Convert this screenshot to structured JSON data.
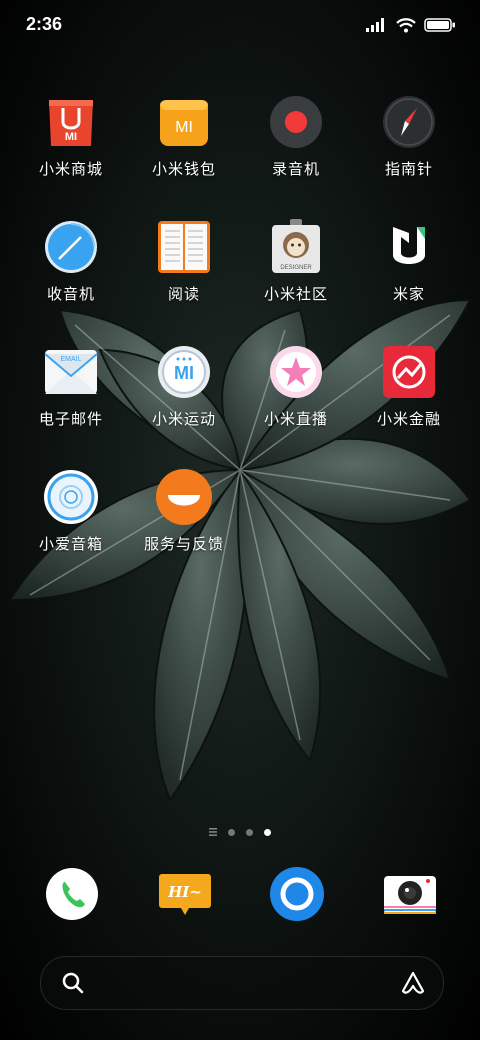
{
  "status_bar": {
    "time": "2:36"
  },
  "apps": [
    {
      "label": "小米商城",
      "icon": "mi-store-icon"
    },
    {
      "label": "小米钱包",
      "icon": "mi-wallet-icon"
    },
    {
      "label": "录音机",
      "icon": "recorder-icon"
    },
    {
      "label": "指南针",
      "icon": "compass-icon"
    },
    {
      "label": "收音机",
      "icon": "radio-icon"
    },
    {
      "label": "阅读",
      "icon": "reader-icon"
    },
    {
      "label": "小米社区",
      "icon": "mi-community-icon"
    },
    {
      "label": "米家",
      "icon": "mijia-icon"
    },
    {
      "label": "电子邮件",
      "icon": "email-icon"
    },
    {
      "label": "小米运动",
      "icon": "mi-fit-icon"
    },
    {
      "label": "小米直播",
      "icon": "mi-live-icon"
    },
    {
      "label": "小米金融",
      "icon": "mi-finance-icon"
    },
    {
      "label": "小爱音箱",
      "icon": "xiaoai-speaker-icon"
    },
    {
      "label": "服务与反馈",
      "icon": "service-feedback-icon"
    }
  ],
  "wallpaper": {
    "accent": "#5e6f69"
  },
  "dock": {
    "apps": [
      "phone-icon",
      "messages-icon",
      "browser-icon",
      "camera-icon"
    ],
    "email_badge": "EMAIL",
    "messages_text": "HI~"
  },
  "page_indicator": {
    "pages": 4,
    "current": 3
  },
  "colors": {
    "store": "#e8452c",
    "wallet": "#f7a21b",
    "record": "#f23a3a",
    "radio": "#3aa3f0",
    "live": "#f47fb8",
    "finance": "#e8293a",
    "service": "#f47a1e",
    "phone": "#3ec25a",
    "browser": "#1f87e8"
  }
}
